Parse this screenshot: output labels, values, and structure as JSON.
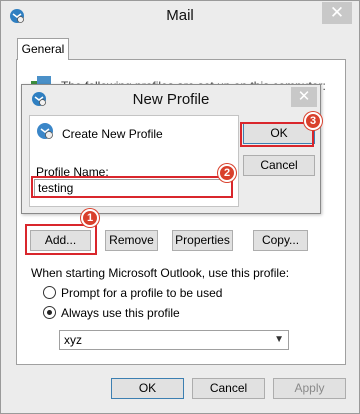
{
  "window": {
    "title": "Mail",
    "close_glyph": "✕",
    "icon": "mail-app-icon"
  },
  "tabs": [
    {
      "label": "General",
      "selected": true
    }
  ],
  "background_text": "The following profiles are set up on this computer:",
  "profile_buttons": {
    "add": "Add...",
    "remove": "Remove",
    "properties": "Properties",
    "copy": "Copy..."
  },
  "startup": {
    "label": "When starting Microsoft Outlook, use this profile:",
    "options": [
      {
        "label": "Prompt for a profile to be used",
        "checked": false
      },
      {
        "label": "Always use this profile",
        "checked": true
      }
    ],
    "selected_profile": "xyz"
  },
  "footer": {
    "ok": "OK",
    "cancel": "Cancel",
    "apply": "Apply"
  },
  "dialog": {
    "title": "New Profile",
    "close_glyph": "✕",
    "heading": "Create New Profile",
    "name_label": "Profile Name:",
    "name_value": "testing",
    "ok": "OK",
    "cancel": "Cancel"
  },
  "callouts": {
    "step1": "1",
    "step2": "2",
    "step3": "3",
    "color": "#d9262c"
  }
}
